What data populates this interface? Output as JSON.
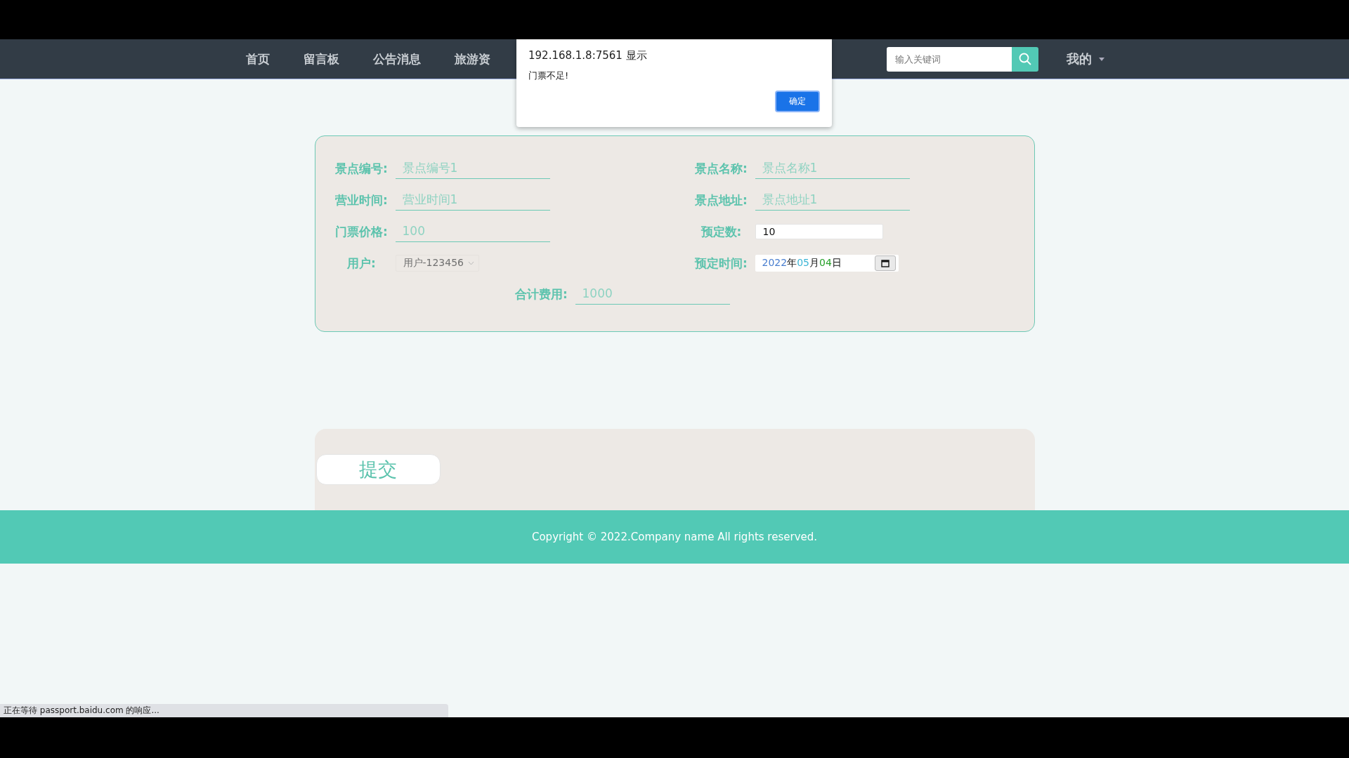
{
  "nav": {
    "items": [
      {
        "label": "首页"
      },
      {
        "label": "留言板"
      },
      {
        "label": "公告消息"
      },
      {
        "label": "旅游资"
      }
    ],
    "search": {
      "placeholder": "输入关键词"
    },
    "user_menu": "我的"
  },
  "browser_dialog": {
    "title": "192.168.1.8:7561 显示",
    "message": "门票不足!",
    "button": "确定"
  },
  "form": {
    "fields": [
      {
        "label": "景点编号:",
        "kind": "text",
        "value": "景点编号1"
      },
      {
        "label": "景点名称:",
        "kind": "text",
        "value": "景点名称1"
      },
      {
        "label": "营业时间:",
        "kind": "text",
        "value": "营业时间1"
      },
      {
        "label": "景点地址:",
        "kind": "text",
        "value": "景点地址1"
      },
      {
        "label": "门票价格:",
        "kind": "text",
        "value": "100"
      },
      {
        "label": "预定数:",
        "kind": "number",
        "value": "10"
      },
      {
        "label": "用户:",
        "kind": "select",
        "value": "用户-123456"
      },
      {
        "label": "预定时间:",
        "kind": "date",
        "segments": [
          {
            "kind": "year",
            "text": "2022"
          },
          {
            "kind": "sep",
            "text": "年"
          },
          {
            "kind": "month",
            "text": "05"
          },
          {
            "kind": "sep",
            "text": "月"
          },
          {
            "kind": "day",
            "text": "04"
          },
          {
            "kind": "sep",
            "text": "日"
          }
        ]
      }
    ],
    "total": {
      "label": "合计费用:",
      "value": "1000"
    }
  },
  "submit": "提交",
  "footer": "Copyright © 2022.Company name All rights reserved.",
  "status_bar": "正在等待 passport.baidu.com 的响应..."
}
